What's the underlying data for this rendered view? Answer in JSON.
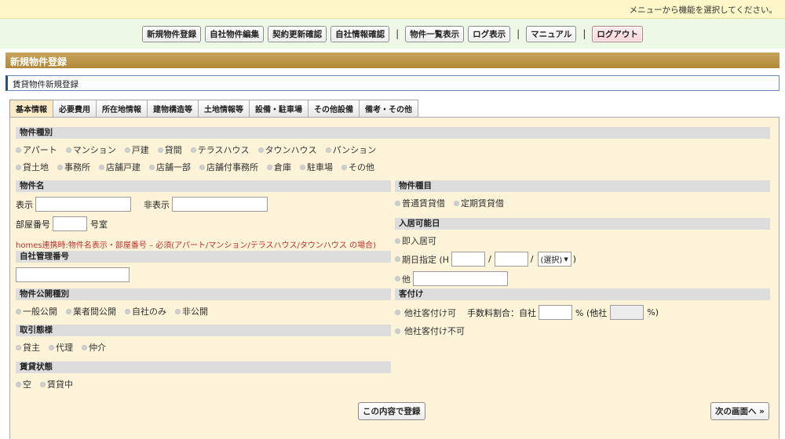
{
  "topbar": {
    "message": "メニューから機能を選択してください。"
  },
  "menu": {
    "items": [
      "新規物件登録",
      "自社物件編集",
      "契約更新確認",
      "自社情報確認"
    ],
    "sep": "|",
    "items2": [
      "物件一覧表示",
      "ログ表示"
    ],
    "manual": "マニュアル",
    "logout": "ログアウト"
  },
  "page": {
    "title": "新規物件登録",
    "subtitle": "賃貸物件新規登録"
  },
  "tabs": [
    "基本情報",
    "必要費用",
    "所在地情報",
    "建物構造等",
    "土地情報等",
    "設備・駐車場",
    "その他設備",
    "備考・その他"
  ],
  "property_type": {
    "title": "物件種別",
    "row1": [
      "アパート",
      "マンション",
      "戸建",
      "貸間",
      "テラスハウス",
      "タウンハウス",
      "パンション"
    ],
    "row2": [
      "貸土地",
      "事務所",
      "店舗戸建",
      "店舗一部",
      "店舗付事務所",
      "倉庫",
      "駐車場",
      "その他"
    ]
  },
  "property_name": {
    "title": "物件名",
    "display_label": "表示",
    "hidden_label": "非表示",
    "room_label": "部屋番号",
    "room_suffix": "号室",
    "note": "homes連携時:物件名表示・部屋番号 – 必須(アパート/マンション/テラスハウス/タウンハウス の場合)"
  },
  "management_no": {
    "title": "自社管理番号"
  },
  "publication": {
    "title": "物件公開種別",
    "options": [
      "一般公開",
      "業者間公開",
      "自社のみ",
      "非公開"
    ]
  },
  "transaction": {
    "title": "取引態様",
    "options": [
      "貸主",
      "代理",
      "仲介"
    ]
  },
  "rental_status": {
    "title": "賃貸状態",
    "options": [
      "空",
      "賃貸中"
    ]
  },
  "contract_type": {
    "title": "物件種目",
    "options": [
      "普通賃貸借",
      "定期賃貸借"
    ]
  },
  "move_in": {
    "title": "入居可能日",
    "immediate": "即入居可",
    "scheduled": "期日指定 (H",
    "slash": "/",
    "select_value": "(選択)",
    "close": ")",
    "other": "他"
  },
  "placement": {
    "title": "客付け",
    "allowed": "他社客付け可",
    "fee_label": "手数料割合：自社",
    "fee_mid": "% (他社",
    "fee_end": "%)",
    "not_allowed": "他社客付け不可"
  },
  "buttons": {
    "register": "この内容で登録",
    "next": "次の画面へ »"
  },
  "icons": {
    "dropdown": "▼"
  }
}
